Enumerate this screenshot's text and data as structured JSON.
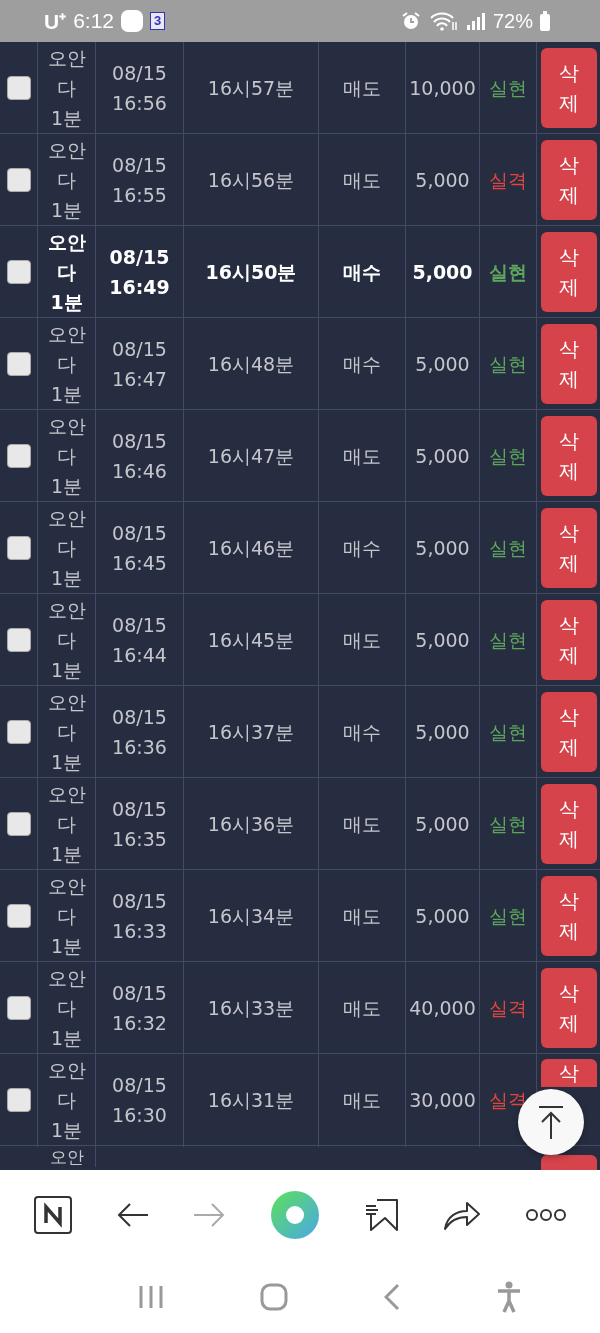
{
  "status_bar": {
    "carrier": "U⁺",
    "time": "6:12",
    "badge": "3",
    "battery": "72%"
  },
  "rows": [
    {
      "kind": "full",
      "checked": false,
      "highlighted": false,
      "name": "오안다 1분",
      "date": "08/15 16:56",
      "slot": "16시57분",
      "side": "매도",
      "amount": "10,000",
      "result": {
        "text": "실현",
        "color": "#5ea65e"
      },
      "action": "삭제"
    },
    {
      "kind": "full",
      "checked": false,
      "highlighted": false,
      "name": "오안다 1분",
      "date": "08/15 16:55",
      "slot": "16시56분",
      "side": "매도",
      "amount": "5,000",
      "result": {
        "text": "실격",
        "color": "#e0453f"
      },
      "action": "삭제"
    },
    {
      "kind": "full",
      "checked": false,
      "highlighted": true,
      "name": "오안다 1분",
      "date": "08/15 16:49",
      "slot": "16시50분",
      "side": "매수",
      "amount": "5,000",
      "result": {
        "text": "실현",
        "color": "#5ea65e"
      },
      "action": "삭제"
    },
    {
      "kind": "full",
      "checked": false,
      "highlighted": false,
      "name": "오안다 1분",
      "date": "08/15 16:47",
      "slot": "16시48분",
      "side": "매수",
      "amount": "5,000",
      "result": {
        "text": "실현",
        "color": "#5ea65e"
      },
      "action": "삭제"
    },
    {
      "kind": "full",
      "checked": false,
      "highlighted": false,
      "name": "오안다 1분",
      "date": "08/15 16:46",
      "slot": "16시47분",
      "side": "매도",
      "amount": "5,000",
      "result": {
        "text": "실현",
        "color": "#5ea65e"
      },
      "action": "삭제"
    },
    {
      "kind": "full",
      "checked": false,
      "highlighted": false,
      "name": "오안다 1분",
      "date": "08/15 16:45",
      "slot": "16시46분",
      "side": "매수",
      "amount": "5,000",
      "result": {
        "text": "실현",
        "color": "#5ea65e"
      },
      "action": "삭제"
    },
    {
      "kind": "full",
      "checked": false,
      "highlighted": false,
      "name": "오안다 1분",
      "date": "08/15 16:44",
      "slot": "16시45분",
      "side": "매도",
      "amount": "5,000",
      "result": {
        "text": "실현",
        "color": "#5ea65e"
      },
      "action": "삭제"
    },
    {
      "kind": "full",
      "checked": false,
      "highlighted": false,
      "name": "오안다 1분",
      "date": "08/15 16:36",
      "slot": "16시37분",
      "side": "매수",
      "amount": "5,000",
      "result": {
        "text": "실현",
        "color": "#5ea65e"
      },
      "action": "삭제"
    },
    {
      "kind": "full",
      "checked": false,
      "highlighted": false,
      "name": "오안다 1분",
      "date": "08/15 16:35",
      "slot": "16시36분",
      "side": "매도",
      "amount": "5,000",
      "result": {
        "text": "실현",
        "color": "#5ea65e"
      },
      "action": "삭제"
    },
    {
      "kind": "full",
      "checked": false,
      "highlighted": false,
      "name": "오안다 1분",
      "date": "08/15 16:33",
      "slot": "16시34분",
      "side": "매도",
      "amount": "5,000",
      "result": {
        "text": "실현",
        "color": "#5ea65e"
      },
      "action": "삭제"
    },
    {
      "kind": "full",
      "checked": false,
      "highlighted": false,
      "name": "오안다 1분",
      "date": "08/15 16:32",
      "slot": "16시33분",
      "side": "매도",
      "amount": "40,000",
      "result": {
        "text": "실격",
        "color": "#e0453f"
      },
      "action": "삭제"
    },
    {
      "kind": "covered",
      "checked": false,
      "highlighted": false,
      "name": "오안다 1분",
      "date": "08/15 16:30",
      "slot": "16시31분",
      "side": "매도",
      "amount": "30,000",
      "result": {
        "text": "실격",
        "color": "#e0453f"
      },
      "action": "삭"
    },
    {
      "kind": "partial",
      "name": "오안"
    }
  ]
}
